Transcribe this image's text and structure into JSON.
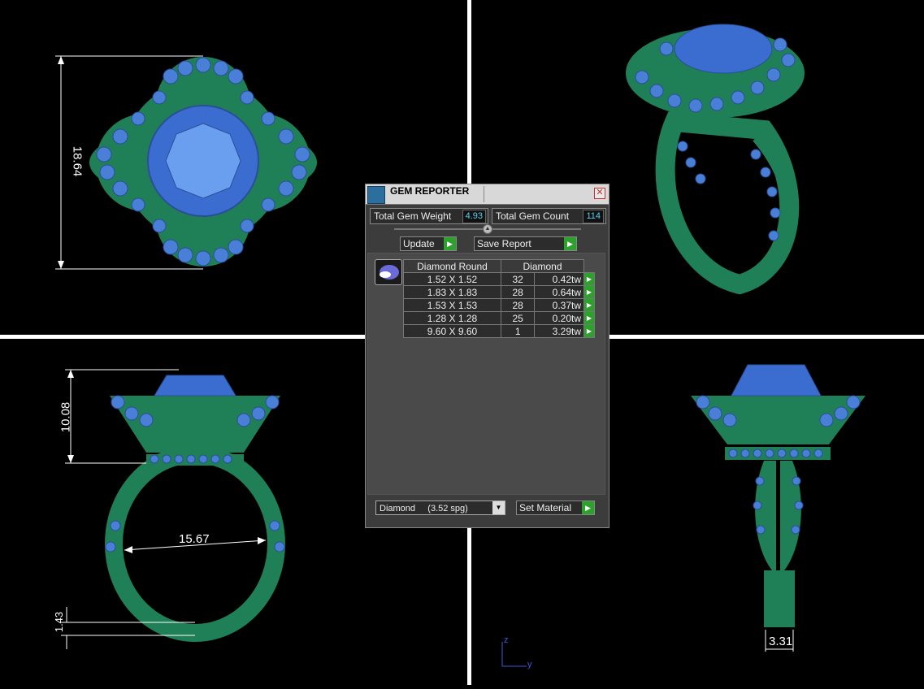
{
  "dimensions": {
    "top_height": "18.64",
    "front_height": "10.08",
    "front_inner_diameter": "15.67",
    "front_shank_thickness": "1.43",
    "side_shank_width": "3.31"
  },
  "axis": {
    "z": "z",
    "y": "y"
  },
  "gem_reporter": {
    "title": "GEM REPORTER",
    "close_label": "✕",
    "total_weight_label": "Total Gem Weight",
    "total_weight_value": "4.93",
    "total_count_label": "Total Gem Count",
    "total_count_value": "114",
    "update_label": "Update",
    "save_report_label": "Save Report",
    "table": {
      "col_shape": "Diamond Round",
      "col_material": "Diamond",
      "rows": [
        {
          "size": "1.52 X 1.52",
          "count": "32",
          "weight": "0.42tw"
        },
        {
          "size": "1.83 X 1.83",
          "count": "28",
          "weight": "0.64tw"
        },
        {
          "size": "1.53 X 1.53",
          "count": "28",
          "weight": "0.37tw"
        },
        {
          "size": "1.28 X 1.28",
          "count": "25",
          "weight": "0.20tw"
        },
        {
          "size": "9.60 X 9.60",
          "count": "1",
          "weight": "3.29tw"
        }
      ]
    },
    "material_select": "Diamond     (3.52 spg)",
    "set_material_label": "Set Material"
  },
  "colors": {
    "metal": "#1f7f56",
    "gem": "#4a7fd8",
    "background": "#000000",
    "value_text": "#5ad0f0"
  }
}
